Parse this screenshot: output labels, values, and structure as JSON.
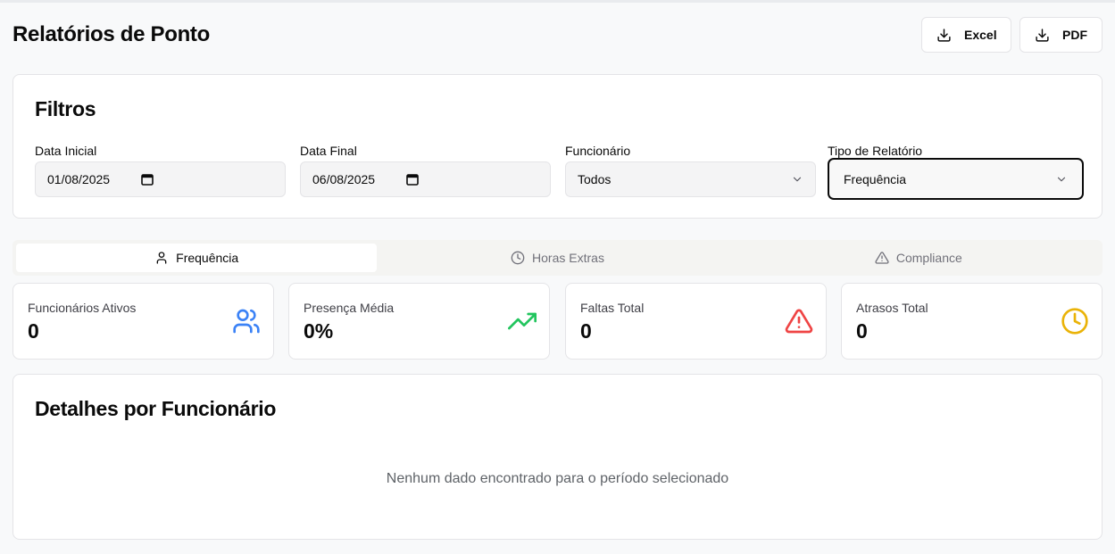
{
  "page": {
    "title": "Relatórios de Ponto"
  },
  "export": {
    "excel_label": "Excel",
    "pdf_label": "PDF"
  },
  "filters": {
    "title": "Filtros",
    "start_date": {
      "label": "Data Inicial",
      "value": "01/08/2025"
    },
    "end_date": {
      "label": "Data Final",
      "value": "06/08/2025"
    },
    "employee": {
      "label": "Funcionário",
      "selected": "Todos"
    },
    "report_type": {
      "label": "Tipo de Relatório",
      "selected": "Frequência"
    }
  },
  "tabs": [
    {
      "label": "Frequência",
      "icon": "users-icon",
      "active": true
    },
    {
      "label": "Horas Extras",
      "icon": "clock-icon",
      "active": false
    },
    {
      "label": "Compliance",
      "icon": "warning-icon",
      "active": false
    }
  ],
  "stats": [
    {
      "label": "Funcionários Ativos",
      "value": "0",
      "icon": "users-icon",
      "color": "#3b82f6"
    },
    {
      "label": "Presença Média",
      "value": "0%",
      "icon": "trending-up-icon",
      "color": "#22c55e"
    },
    {
      "label": "Faltas Total",
      "value": "0",
      "icon": "alert-triangle-icon",
      "color": "#ef4444"
    },
    {
      "label": "Atrasos Total",
      "value": "0",
      "icon": "clock-icon",
      "color": "#eab308"
    }
  ],
  "details": {
    "title": "Detalhes por Funcionário",
    "empty_message": "Nenhum dado encontrado para o período selecionado"
  }
}
